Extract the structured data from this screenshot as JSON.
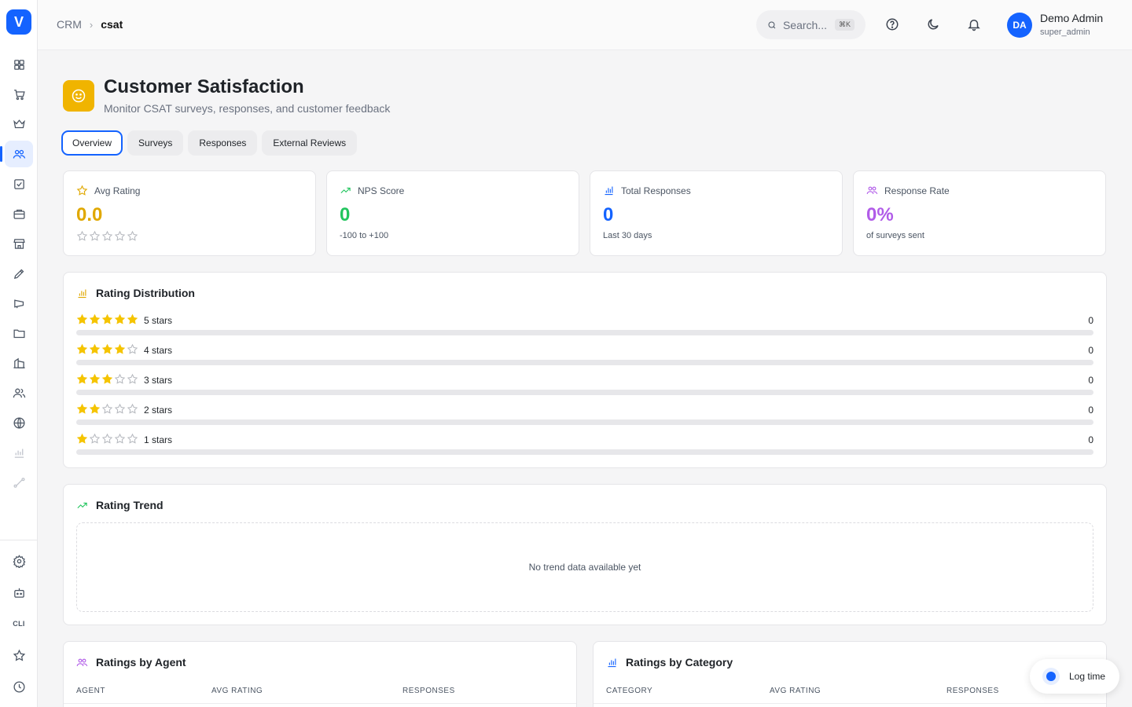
{
  "app": {
    "logo_letter": "V"
  },
  "breadcrumb": {
    "root": "CRM",
    "separator": ">",
    "current": "csat"
  },
  "search": {
    "placeholder": "Search...",
    "shortcut": "⌘K"
  },
  "user": {
    "initials": "DA",
    "name": "Demo Admin",
    "role": "super_admin"
  },
  "sidebar": {
    "items": [
      {
        "icon": "grid-icon"
      },
      {
        "icon": "cart-icon"
      },
      {
        "icon": "crown-icon"
      },
      {
        "icon": "users-icon",
        "active": true
      },
      {
        "icon": "checkbox-icon"
      },
      {
        "icon": "briefcase-icon"
      },
      {
        "icon": "store-icon"
      },
      {
        "icon": "pen-icon"
      },
      {
        "icon": "megaphone-icon"
      },
      {
        "icon": "folder-icon"
      },
      {
        "icon": "building-icon"
      },
      {
        "icon": "team-icon"
      },
      {
        "icon": "globe-icon"
      },
      {
        "icon": "bar-chart-icon"
      },
      {
        "icon": "route-icon"
      }
    ],
    "bottom": [
      {
        "icon": "settings-icon"
      },
      {
        "icon": "bot-icon"
      },
      {
        "icon": "cli-icon",
        "label": "CLI"
      },
      {
        "icon": "star-icon"
      },
      {
        "icon": "clock-icon"
      }
    ]
  },
  "page": {
    "title": "Customer Satisfaction",
    "subtitle": "Monitor CSAT surveys, responses, and customer feedback"
  },
  "tabs": [
    {
      "label": "Overview",
      "active": true
    },
    {
      "label": "Surveys"
    },
    {
      "label": "Responses"
    },
    {
      "label": "External Reviews"
    }
  ],
  "stats": {
    "avg_rating": {
      "label": "Avg Rating",
      "value": "0.0",
      "stars": 0,
      "color": "#e0a800"
    },
    "nps": {
      "label": "NPS Score",
      "value": "0",
      "sub": "-100 to +100",
      "color": "#22c55e"
    },
    "total": {
      "label": "Total Responses",
      "value": "0",
      "sub": "Last 30 days",
      "color": "#1463ff"
    },
    "rate": {
      "label": "Response Rate",
      "value": "0%",
      "sub": "of surveys sent",
      "color": "#b15ce8"
    }
  },
  "distribution": {
    "title": "Rating Distribution",
    "rows": [
      {
        "stars": 5,
        "label": "5 stars",
        "count": "0",
        "fraction": 0
      },
      {
        "stars": 4,
        "label": "4 stars",
        "count": "0",
        "fraction": 0
      },
      {
        "stars": 3,
        "label": "3 stars",
        "count": "0",
        "fraction": 0
      },
      {
        "stars": 2,
        "label": "2 stars",
        "count": "0",
        "fraction": 0
      },
      {
        "stars": 1,
        "label": "1 stars",
        "count": "0",
        "fraction": 0
      }
    ]
  },
  "trend": {
    "title": "Rating Trend",
    "empty": "No trend data available yet"
  },
  "agent_table": {
    "title": "Ratings by Agent",
    "columns": [
      "Agent",
      "Avg Rating",
      "Responses"
    ]
  },
  "category_table": {
    "title": "Ratings by Category",
    "columns": [
      "Category",
      "Avg Rating",
      "Responses"
    ]
  },
  "log_time": {
    "label": "Log time"
  },
  "colors": {
    "accent": "#1463ff",
    "star": "#f5c400",
    "header_icon": "#f0b400"
  }
}
